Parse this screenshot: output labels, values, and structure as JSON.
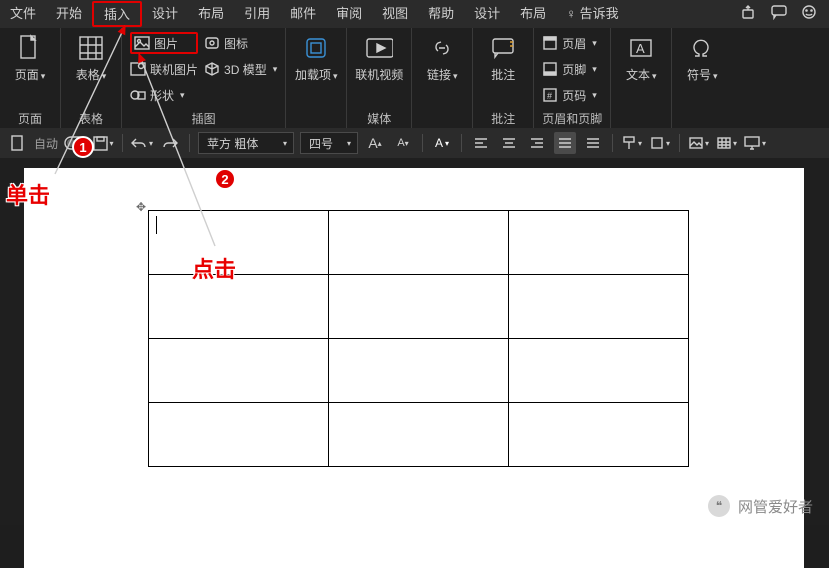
{
  "tabs": {
    "file": "文件",
    "home": "开始",
    "insert": "插入",
    "design": "设计",
    "layout": "布局",
    "references": "引用",
    "mailings": "邮件",
    "review": "审阅",
    "view": "视图",
    "help": "帮助",
    "design2": "设计",
    "layout2": "布局",
    "tellme": "告诉我"
  },
  "ribbon": {
    "pages": {
      "label": "页面",
      "page": "页面"
    },
    "tables": {
      "label": "表格",
      "table": "表格"
    },
    "illustrations": {
      "label": "插图",
      "pictures": "图片",
      "online_pictures": "联机图片",
      "shapes": "形状",
      "icons": "图标",
      "models": "3D 模型"
    },
    "addins": {
      "label": "",
      "addin": "加载项"
    },
    "media": {
      "label": "媒体",
      "online_video": "联机视频"
    },
    "links": {
      "label": "",
      "links": "链接"
    },
    "comments": {
      "label": "批注",
      "comment": "批注"
    },
    "headerfooter": {
      "label": "页眉和页脚",
      "header": "页眉",
      "footer": "页脚",
      "pagenum": "页码"
    },
    "text": {
      "label": "",
      "text": "文本"
    },
    "symbols": {
      "label": "",
      "symbol": "符号"
    }
  },
  "qat": {
    "autosave": "自动",
    "font": "苹方 粗体",
    "fontsize": "四号"
  },
  "annotations": {
    "badge1": "1",
    "badge2": "2",
    "click_single": "单击",
    "click_tap": "点击"
  },
  "watermark": {
    "text": "网管爱好者"
  }
}
